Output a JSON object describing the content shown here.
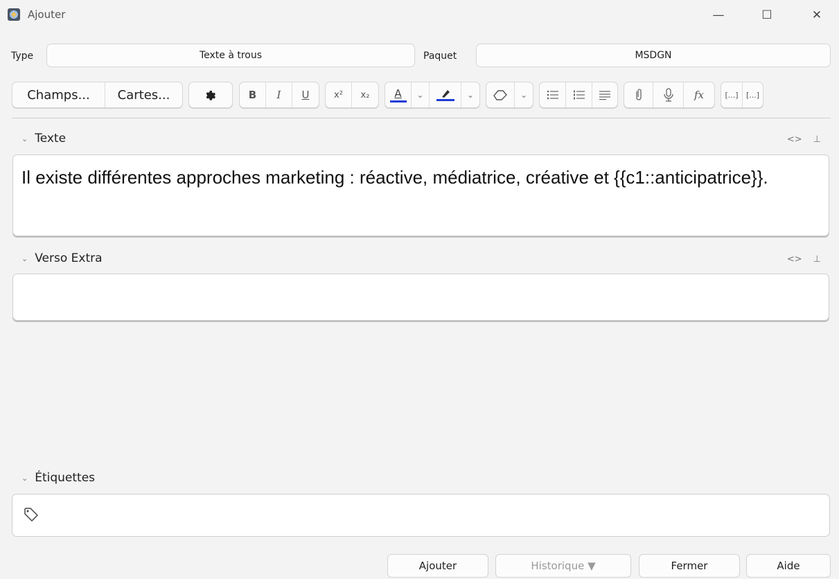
{
  "window": {
    "title": "Ajouter",
    "min": "—",
    "max": "☐",
    "close": "✕"
  },
  "header": {
    "type_label": "Type",
    "type_value": "Texte à trous",
    "deck_label": "Paquet",
    "deck_value": "MSDGN"
  },
  "toolbar": {
    "fields_label": "Champs...",
    "cards_label": "Cartes...",
    "bold": "B",
    "italic": "I",
    "underline": "U",
    "superscript": "x²",
    "subscript": "x₂",
    "text_color_letter": "A",
    "text_color": "#1f3bd6",
    "highlight_color": "#1f3bd6",
    "function_label": "fx",
    "cloze_new": "[...]",
    "cloze_same": "[...]"
  },
  "fields": [
    {
      "name": "Texte",
      "value": "Il existe différentes approches marketing : réactive, médiatrice, créative et {{c1::anticipatrice}}."
    },
    {
      "name": "Verso Extra",
      "value": ""
    }
  ],
  "field_tools": {
    "html": "<>",
    "pin": "⊥"
  },
  "tags": {
    "label": "Étiquettes"
  },
  "buttons": {
    "add": "Ajouter",
    "history": "Historique ▼",
    "close": "Fermer",
    "help": "Aide"
  }
}
